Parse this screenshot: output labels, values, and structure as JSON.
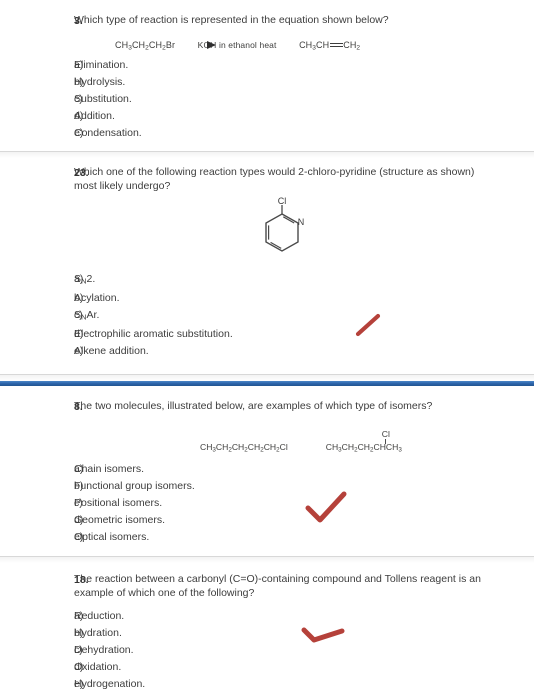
{
  "document": {
    "type": "chemistry-multiple-choice-worksheet",
    "accent_blue": "#2a62a8",
    "annotation_red": "#c0392b"
  },
  "questions": [
    {
      "number": "3.",
      "text": "Which type of reaction is represented in the equation shown below?",
      "equation": {
        "reactant": "CH3CH2CH2Br",
        "reactant_parts": [
          {
            "t": "CH",
            "sub": "3"
          },
          {
            "t": "CH",
            "sub": "2"
          },
          {
            "t": "CH",
            "sub": "2"
          },
          {
            "t": "Br",
            "sub": ""
          }
        ],
        "above_arrow": "KOH",
        "below_arrow_line1": "in ethanol",
        "below_arrow_line2": "heat",
        "product": "CH3CH=CH2",
        "product_left_parts": [
          {
            "t": "CH",
            "sub": "3"
          },
          {
            "t": "CH",
            "sub": ""
          }
        ],
        "product_bond": "double-bond",
        "product_right_parts": [
          {
            "t": "CH",
            "sub": "2"
          }
        ]
      },
      "options": [
        {
          "letter": "a)",
          "text": "Elimination."
        },
        {
          "letter": "b)",
          "text": "Hydrolysis."
        },
        {
          "letter": "c)",
          "text": "Substitution."
        },
        {
          "letter": "d)",
          "text": "Addition."
        },
        {
          "letter": "e)",
          "text": "Condensation."
        }
      ],
      "annotation": null
    },
    {
      "number": "23.",
      "text": "Which one of the following reaction types would 2-chloro-pyridine (structure as shown) most likely undergo?",
      "structure": {
        "name": "2-chloro-pyridine",
        "ring": "pyridine",
        "substituent_label": "Cl",
        "heteroatom_label": "N"
      },
      "options": [
        {
          "letter": "a)",
          "text": "SN2.",
          "text_pre": "S",
          "text_sub": "N",
          "text_post": "2."
        },
        {
          "letter": "b)",
          "text": "Acylation."
        },
        {
          "letter": "c)",
          "text": "SNAr.",
          "text_pre": "S",
          "text_sub": "N",
          "text_post": "Ar."
        },
        {
          "letter": "d)",
          "text": "Electrophilic aromatic substitution."
        },
        {
          "letter": "e)",
          "text": "Alkene addition."
        }
      ],
      "annotation": "red-slash-mark"
    },
    {
      "number": "8.",
      "text": "The two molecules, illustrated below, are examples of which type of isomers?",
      "molecules": {
        "left": "CH3CH2CH2CH2CH2Cl",
        "left_parts": [
          {
            "t": "CH",
            "sub": "3"
          },
          {
            "t": "CH",
            "sub": "2"
          },
          {
            "t": "CH",
            "sub": "2"
          },
          {
            "t": "CH",
            "sub": "2"
          },
          {
            "t": "CH",
            "sub": "2"
          },
          {
            "t": "Cl",
            "sub": ""
          }
        ],
        "right": "CH3CH2CH2CHCH3",
        "right_parts": [
          {
            "t": "CH",
            "sub": "3"
          },
          {
            "t": "CH",
            "sub": "2"
          },
          {
            "t": "CH",
            "sub": "2"
          },
          {
            "t": "CH",
            "sub": ""
          },
          {
            "t": "CH",
            "sub": "3"
          }
        ],
        "right_branch_label": "Cl"
      },
      "options": [
        {
          "letter": "a)",
          "text": "Chain isomers."
        },
        {
          "letter": "b)",
          "text": "Functional group isomers."
        },
        {
          "letter": "c)",
          "text": "Positional isomers."
        },
        {
          "letter": "d)",
          "text": "Geometric isomers."
        },
        {
          "letter": "e)",
          "text": "Optical isomers."
        }
      ],
      "annotation": "red-check-mark"
    },
    {
      "number": "18.",
      "text": "The reaction between a carbonyl (C=O)-containing compound and Tollens reagent is an example of which one of the following?",
      "options": [
        {
          "letter": "a)",
          "text": "Reduction."
        },
        {
          "letter": "b)",
          "text": "Hydration."
        },
        {
          "letter": "c)",
          "text": "Dehydration."
        },
        {
          "letter": "d)",
          "text": "Oxidation."
        },
        {
          "letter": "e)",
          "text": "Hydrogenation."
        }
      ],
      "annotation": "red-check-mark-flat"
    }
  ]
}
